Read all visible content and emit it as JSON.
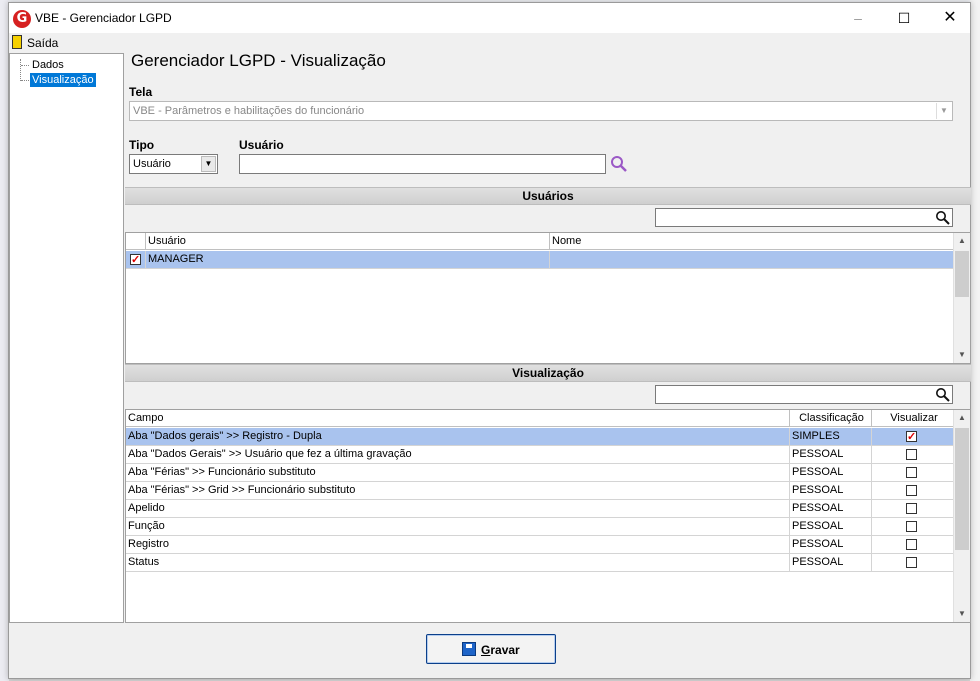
{
  "window": {
    "title": "VBE - Gerenciador LGPD",
    "app_icon_letter": "G"
  },
  "menu": {
    "exit_label": "Saída"
  },
  "tree": {
    "items": [
      {
        "label": "Dados"
      },
      {
        "label": "Visualização"
      }
    ]
  },
  "page": {
    "title": "Gerenciador LGPD - Visualização"
  },
  "tela": {
    "label": "Tela",
    "value": "VBE - Parâmetros e habilitações do funcionário"
  },
  "tipo": {
    "label": "Tipo",
    "value": "Usuário"
  },
  "usuario": {
    "label": "Usuário",
    "value": ""
  },
  "usuarios_section": {
    "title": "Usuários",
    "columns": [
      "Usuário",
      "Nome"
    ],
    "rows": [
      {
        "checked": true,
        "usuario": "MANAGER",
        "nome": ""
      }
    ]
  },
  "visualizacao_section": {
    "title": "Visualização",
    "columns": [
      "Campo",
      "Classificação",
      "Visualizar"
    ],
    "rows": [
      {
        "campo": "Aba \"Dados gerais\" >> Registro - Dupla",
        "classificacao": "SIMPLES",
        "visualizar": true
      },
      {
        "campo": "Aba \"Dados Gerais\" >> Usuário que fez a última gravação",
        "classificacao": "PESSOAL",
        "visualizar": false
      },
      {
        "campo": "Aba \"Férias\" >> Funcionário substituto",
        "classificacao": "PESSOAL",
        "visualizar": false
      },
      {
        "campo": "Aba \"Férias\" >> Grid >> Funcionário substituto",
        "classificacao": "PESSOAL",
        "visualizar": false
      },
      {
        "campo": "Apelido",
        "classificacao": "PESSOAL",
        "visualizar": false
      },
      {
        "campo": "Função",
        "classificacao": "PESSOAL",
        "visualizar": false
      },
      {
        "campo": "Registro",
        "classificacao": "PESSOAL",
        "visualizar": false
      },
      {
        "campo": "Status",
        "classificacao": "PESSOAL",
        "visualizar": false
      }
    ]
  },
  "buttons": {
    "save_label_underlined": "G",
    "save_label_rest": "ravar"
  },
  "colors": {
    "selection": "#a9c3ee",
    "tree_selection": "#0078d7",
    "check_mark": "#dd0000",
    "brand": "#d62020"
  }
}
